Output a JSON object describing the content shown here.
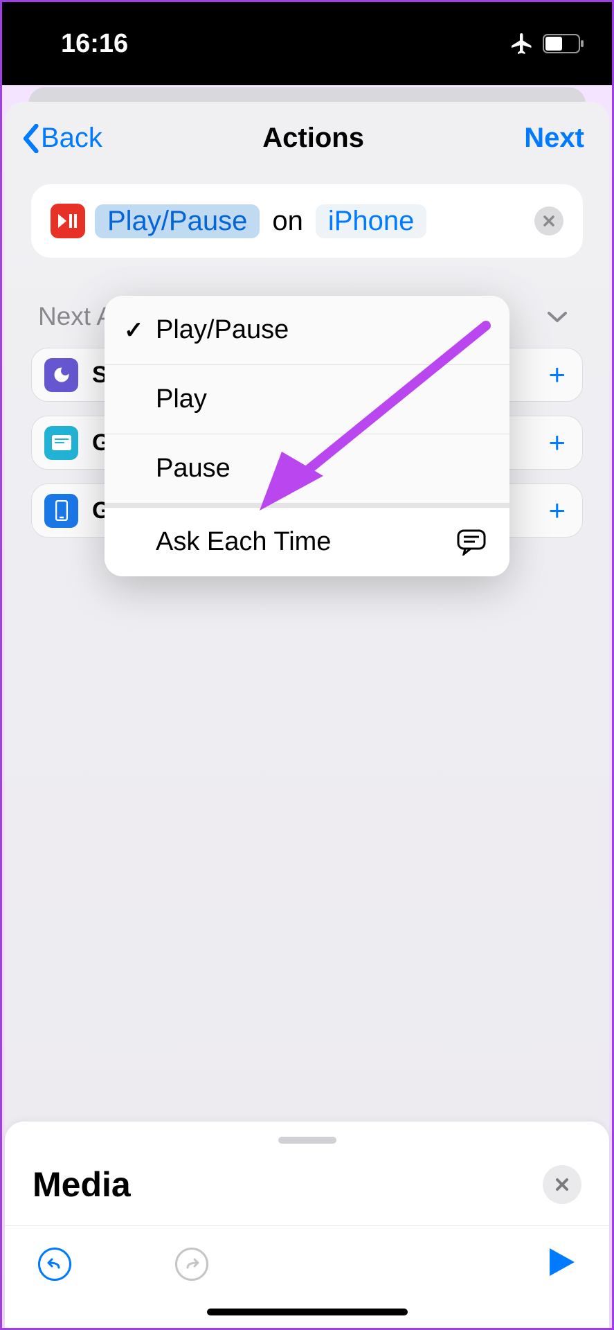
{
  "statusBar": {
    "time": "16:16"
  },
  "nav": {
    "back": "Back",
    "title": "Actions",
    "next": "Next"
  },
  "action": {
    "param1": "Play/Pause",
    "connector": "on",
    "param2": "iPhone"
  },
  "dropdown": {
    "items": [
      "Play/Pause",
      "Play",
      "Pause",
      "Ask Each Time"
    ],
    "checked": 0
  },
  "suggestions": {
    "header": "Next Action Suggestions",
    "items": [
      {
        "label": "Set Focus"
      },
      {
        "label": "Get Current Focus"
      },
      {
        "label": "Get Device Details"
      }
    ]
  },
  "bottomPanel": {
    "title": "Media"
  }
}
